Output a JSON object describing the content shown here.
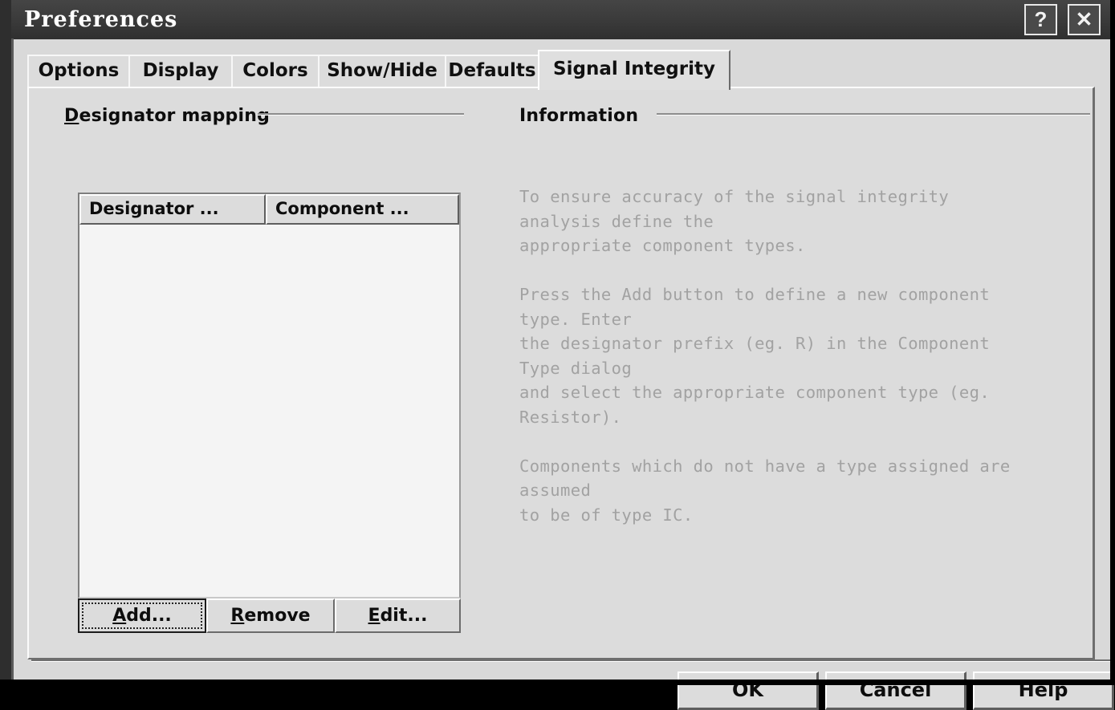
{
  "window": {
    "title": "Preferences",
    "help_button": "?",
    "close_button": "✕"
  },
  "tabs": [
    {
      "label": "Options",
      "active": false
    },
    {
      "label": "Display",
      "active": false
    },
    {
      "label": "Colors",
      "active": false
    },
    {
      "label": "Show/Hide",
      "active": false
    },
    {
      "label": "Defaults",
      "active": false
    },
    {
      "label": "Signal Integrity",
      "active": true
    }
  ],
  "designator_mapping": {
    "group_label_accel": "D",
    "group_label_rest": "esignator mapping",
    "columns": [
      "Designator ...",
      "Component ..."
    ],
    "rows": [],
    "buttons": {
      "add": {
        "accel": "A",
        "rest": "dd...",
        "focused": true
      },
      "remove": {
        "accel": "R",
        "rest": "emove",
        "focused": false
      },
      "edit": {
        "accel": "E",
        "rest": "dit...",
        "focused": false
      }
    }
  },
  "information": {
    "group_label": "Information",
    "body": "To ensure accuracy of the signal integrity\nanalysis define the\nappropriate component types.\n\nPress the Add button to define a new component\ntype. Enter\nthe designator prefix (eg. R) in the Component\nType dialog\nand select the appropriate component type (eg.\nResistor).\n\nComponents which do not have a type assigned are\nassumed\nto be of type IC."
  },
  "dialog_buttons": {
    "ok": "OK",
    "cancel": "Cancel",
    "help": "Help"
  },
  "colors": {
    "titlebar": "#3a3a3a",
    "face": "#dcdcdc",
    "client": "#d9d9d9",
    "listbox": "#f4f4f4",
    "info_text": "#a2a2a2",
    "text": "#0d0d0d",
    "border_dark": "#6b6b6b",
    "border_light": "#ffffff"
  }
}
